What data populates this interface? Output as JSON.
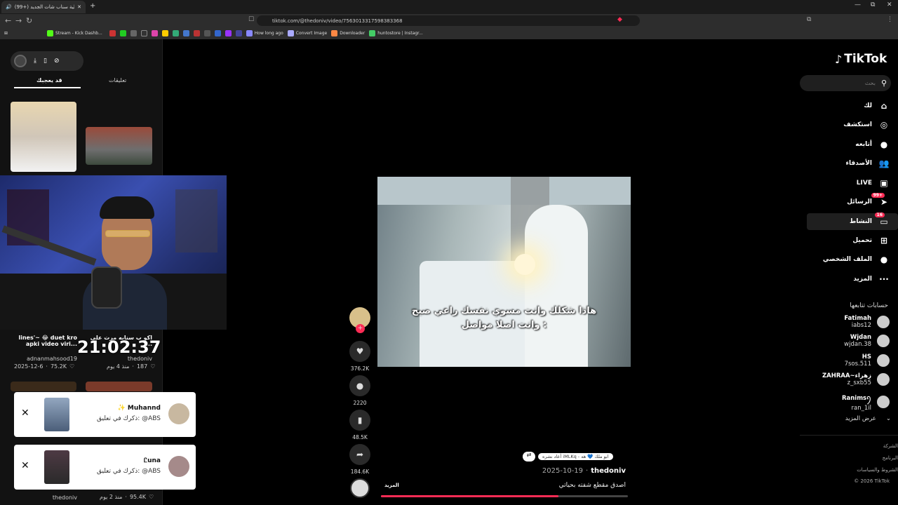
{
  "browser": {
    "tab_title": "(99+) إشكالية سناب شات الجديد...",
    "url": "tiktok.com/@thedoniv/video/7563013317598383368",
    "new_tab_symbol": "+",
    "window_controls": [
      "—",
      "⧉",
      "✕"
    ],
    "bookmarks": [
      {
        "label": "Stream - Kick Dashb...",
        "color": "#53fc18"
      },
      {
        "label": "How long ago",
        "color": "#8888ff"
      },
      {
        "label": "Convert Image",
        "color": "#aaaaff"
      },
      {
        "label": "Downloader",
        "color": "#ff8844"
      },
      {
        "label": "huntostore | Instagr...",
        "color": "#44cc66"
      }
    ]
  },
  "left_panel": {
    "tabs": [
      {
        "label": "تعليقات"
      },
      {
        "label": "قد يعجبك"
      }
    ],
    "cards": [
      {
        "caption": "lines'~ 😂 duet kro apki video viri...",
        "author": "adnanmahsood19",
        "likes": "75.2K",
        "date": "2025-12-6"
      },
      {
        "caption": "اكو ب سنابه مرت علي ...",
        "author": "thedoniv",
        "likes": "187",
        "date": "منذ 4 يوم"
      },
      {
        "author": "thedoniv",
        "likes": "95.4K",
        "date": "منذ 2 يوم"
      }
    ]
  },
  "stream_overlay": {
    "clock": "21:02:37"
  },
  "notifications": [
    {
      "name": "✨ Muhannd",
      "text": "ذكرك في تعليق: @ABS"
    },
    {
      "name": "Ꮭuna",
      "text": "ذكرك في تعليق: @ABS"
    }
  ],
  "video": {
    "subtitle_line1": "هاذا شكلك وانت مسوي نفسك راعي صبح",
    "subtitle_line2": "وانت اصلا مواصل :",
    "author": "thedoniv",
    "date": "2025-10-19",
    "caption": "اصدق مقطع شفته بحياتي",
    "more_label": "المزيد",
    "repost_text": "أعاد نشره iMLKq - ابو ملك 💙 هه",
    "progress": 0.72
  },
  "actions": {
    "likes": "376.2K",
    "comments": "2220",
    "saves": "48.5K",
    "shares": "184.6K"
  },
  "tiktok": {
    "logo": "TikTok",
    "search_placeholder": "بحث",
    "nav": [
      {
        "label": "لك",
        "icon": "home-icon",
        "glyph": "⌂"
      },
      {
        "label": "استكشف",
        "icon": "compass-icon",
        "glyph": "◎"
      },
      {
        "label": "أتابعه",
        "icon": "following-icon",
        "glyph": "●"
      },
      {
        "label": "الأصدقاء",
        "icon": "friends-icon",
        "glyph": "👥"
      },
      {
        "label": "LIVE",
        "icon": "live-icon",
        "glyph": "▣"
      },
      {
        "label": "الرسائل",
        "icon": "messages-icon",
        "glyph": "➤",
        "badge": "99+"
      },
      {
        "label": "النشاط",
        "icon": "activity-icon",
        "glyph": "▭",
        "badge": "16"
      },
      {
        "label": "تحميل",
        "icon": "upload-icon",
        "glyph": "⊞"
      },
      {
        "label": "الملف الشخصي",
        "icon": "profile-icon",
        "glyph": "●"
      },
      {
        "label": "المزيد",
        "icon": "more-icon",
        "glyph": "···"
      }
    ],
    "following_title": "حسابات تتابعها",
    "following": [
      {
        "name": "Fatimah",
        "handle": "iabs12"
      },
      {
        "name": "Wjdan",
        "handle": "wjdan.38"
      },
      {
        "name": "HS",
        "handle": "7sos.511"
      },
      {
        "name": "ZAHRAA~زهراء",
        "handle": "z_sxb55"
      },
      {
        "name": "Ranimsꪆ",
        "handle": "ran_1il"
      }
    ],
    "see_more": "عرض المزيد",
    "footer": [
      "الشركة",
      "البرنامج",
      "الشروط والسياسات",
      "© 2026 TikTok"
    ]
  }
}
